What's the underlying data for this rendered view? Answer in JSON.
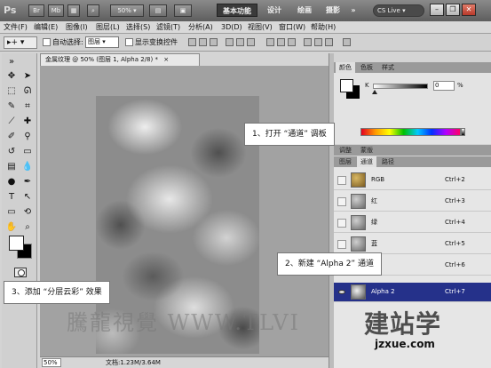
{
  "titlebar": {
    "app_logo": "Ps",
    "bridge_label": "Br",
    "minibridge_label": "Mb",
    "zoom_value": "50%",
    "workspaces": [
      "基本功能",
      "设计",
      "绘画",
      "摄影"
    ],
    "active_workspace": "基本功能",
    "cs_live": "CS Live",
    "window_buttons": [
      "minimize-icon",
      "restore-icon",
      "close-icon"
    ]
  },
  "menubar": {
    "items": [
      "文件(F)",
      "编辑(E)",
      "图像(I)",
      "图层(L)",
      "选择(S)",
      "滤镜(T)",
      "分析(A)",
      "3D(D)",
      "视图(V)",
      "窗口(W)",
      "帮助(H)"
    ]
  },
  "options": {
    "tool_glyph": "▸+",
    "auto_select_label": "自动选择:",
    "auto_select_value": "图层",
    "show_transform_label": "显示变换控件"
  },
  "document": {
    "tab_title": "金属纹理 @ 50% (图层 1, Alpha 2/8) *",
    "zoom": "50%",
    "doc_size": "文档:1.23M/3.64M"
  },
  "annotations": {
    "step1": "1、打开 “通道” 调板",
    "step2": "2、新建 “Alpha 2” 通道",
    "step3": "3、添加 “分层云彩” 效果"
  },
  "watermark": {
    "text": "騰龍視覺 WWW.TLVI",
    "logo_text": "建站学",
    "logo_url": "jzxue.com"
  },
  "color_panel": {
    "tabs": [
      "颜色",
      "色板",
      "样式"
    ],
    "active_tab": "颜色",
    "channel_label": "K",
    "value": "0",
    "unit": "%"
  },
  "adjust_panel": {
    "tabs": [
      "调整",
      "蒙版"
    ]
  },
  "channels_panel": {
    "tabs": [
      "图层",
      "通道",
      "路径"
    ],
    "active_tab": "通道",
    "rows": [
      {
        "name": "RGB",
        "shortcut": "Ctrl+2",
        "thumb": "rgb",
        "visible": false
      },
      {
        "name": "红",
        "shortcut": "Ctrl+3",
        "thumb": "gray",
        "visible": false
      },
      {
        "name": "绿",
        "shortcut": "Ctrl+4",
        "thumb": "gray",
        "visible": false
      },
      {
        "name": "蓝",
        "shortcut": "Ctrl+5",
        "thumb": "gray",
        "visible": false
      },
      {
        "name": "",
        "shortcut": "Ctrl+6",
        "thumb": "gray",
        "visible": false
      },
      {
        "name": "Alpha 2",
        "shortcut": "Ctrl+7",
        "thumb": "alpha",
        "visible": true
      }
    ]
  },
  "colors": {
    "selected_row": "#25318a",
    "titlebar": "#6e6e6e"
  }
}
